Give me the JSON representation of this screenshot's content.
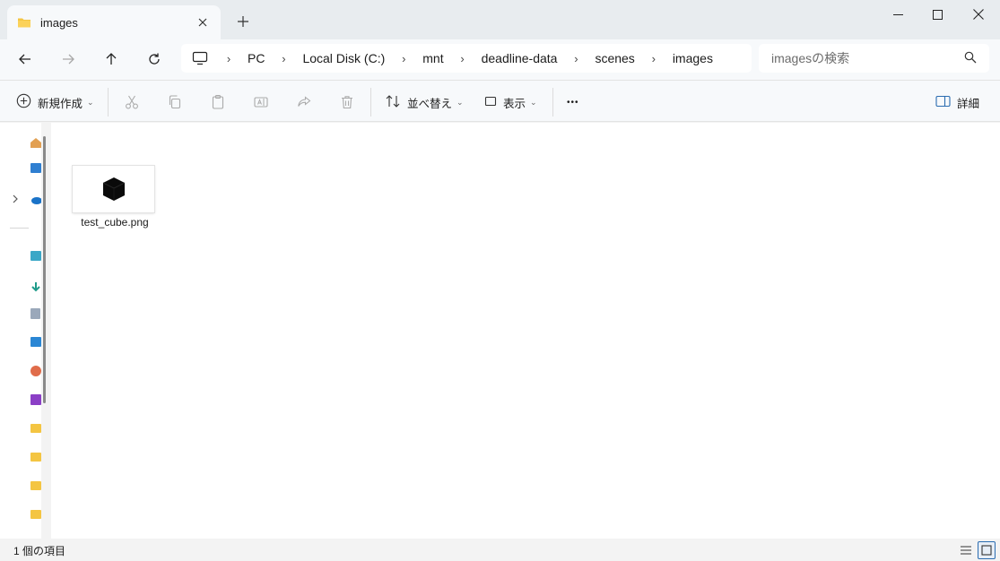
{
  "window": {
    "tab_title": "images",
    "new_tab": "+"
  },
  "address": {
    "crumbs": [
      "PC",
      "Local Disk (C:)",
      "mnt",
      "deadline-data",
      "scenes",
      "images"
    ]
  },
  "search": {
    "placeholder": "imagesの検索"
  },
  "commands": {
    "new_label": "新規作成",
    "sort_label": "並べ替え",
    "view_label": "表示",
    "more_label": "•••",
    "details_label": "詳細"
  },
  "files": [
    {
      "name": "test_cube.png",
      "icon": "cube-thumbnail"
    }
  ],
  "status": {
    "item_count": "1 個の項目"
  },
  "colors": {
    "accent": "#2b6cb0",
    "folder": "#f4c542"
  }
}
